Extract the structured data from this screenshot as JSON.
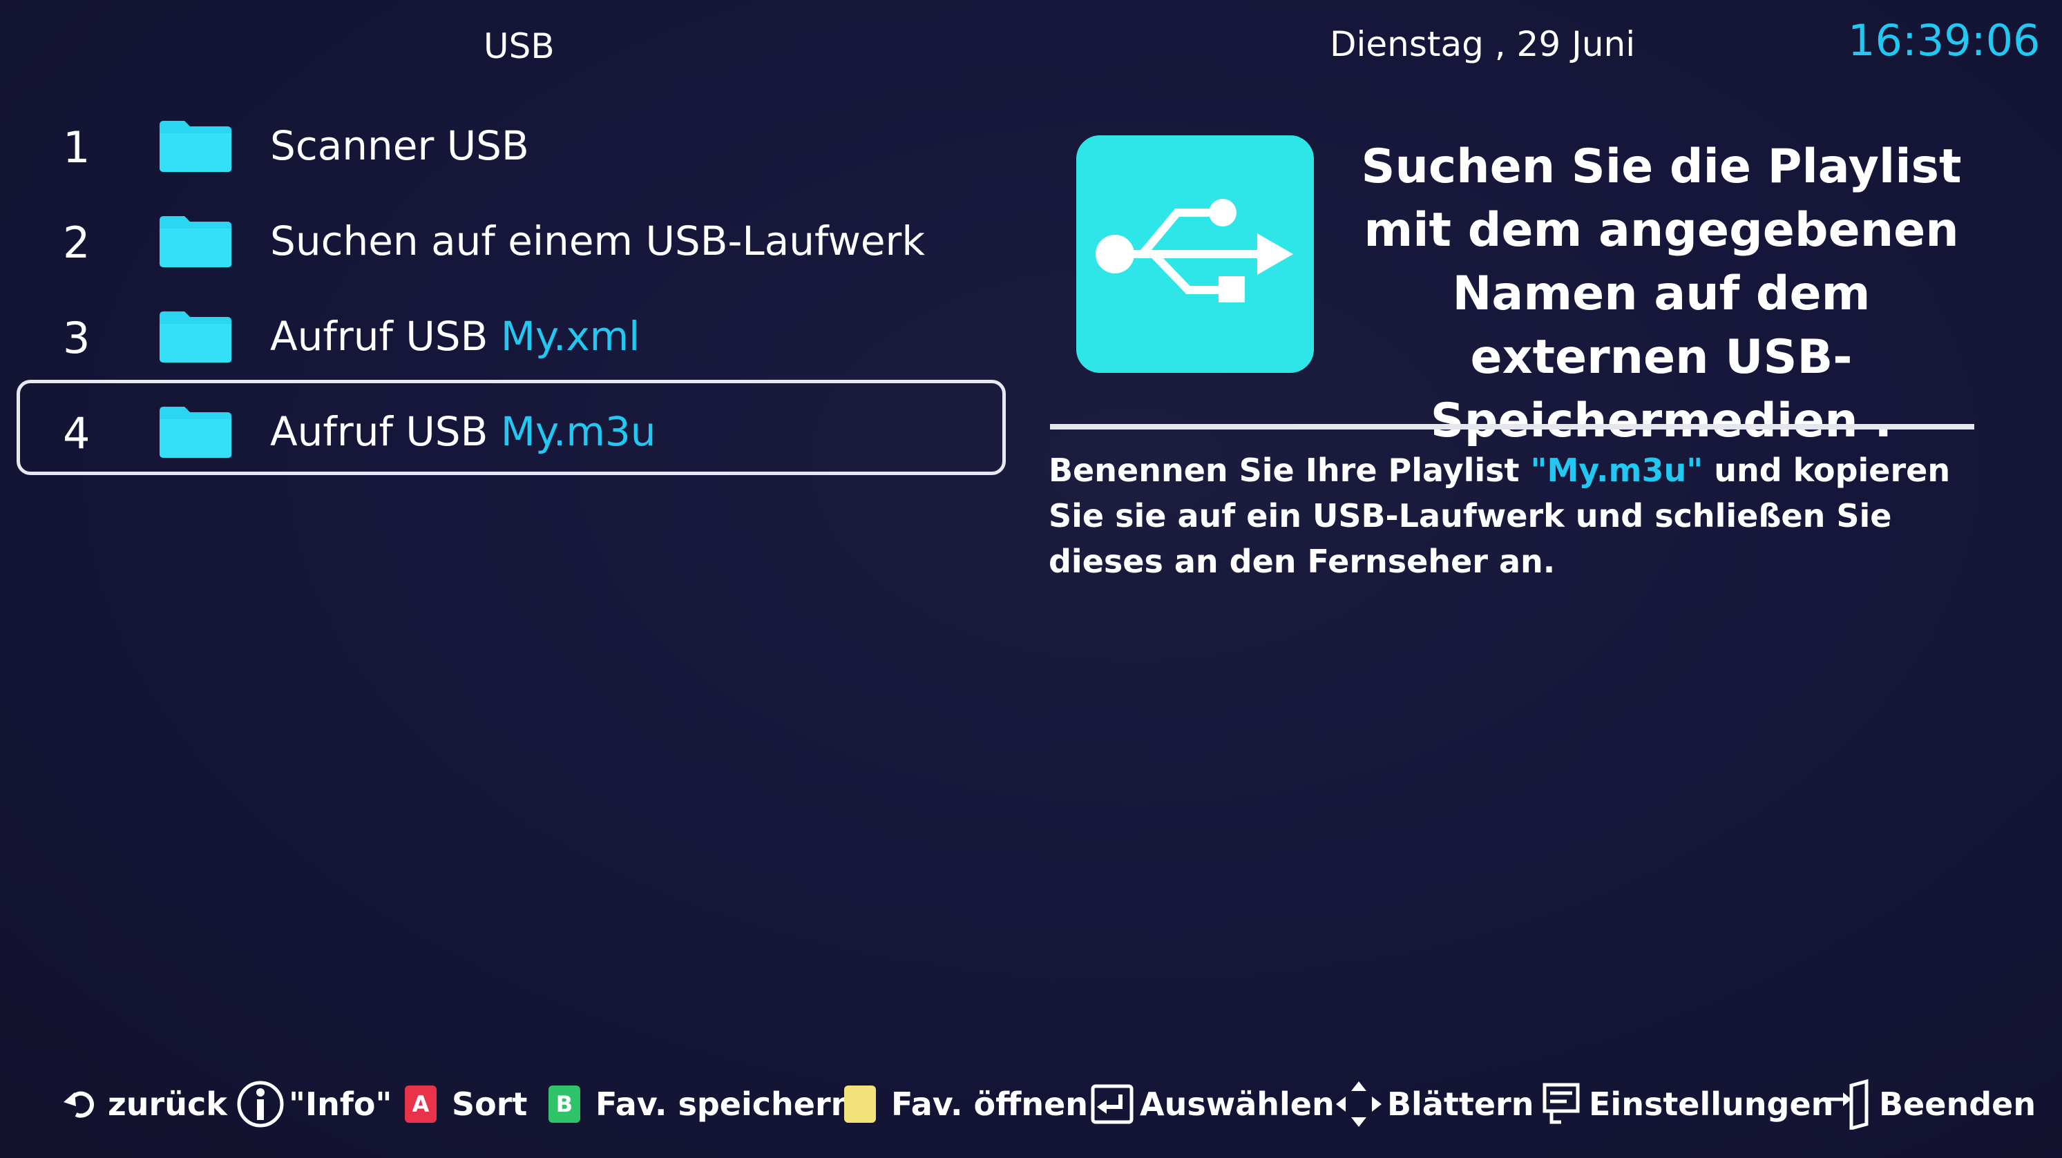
{
  "header": {
    "title": "USB",
    "date": "Dienstag , 29 Juni",
    "time": "16:39:06"
  },
  "list": {
    "items": [
      {
        "number": "1",
        "label": "Scanner USB",
        "highlight": ""
      },
      {
        "number": "2",
        "label": "Suchen auf einem USB-Laufwerk",
        "highlight": ""
      },
      {
        "number": "3",
        "label": "Aufruf USB ",
        "highlight": "My.xml"
      },
      {
        "number": "4",
        "label": "Aufruf USB ",
        "highlight": "My.m3u"
      }
    ],
    "selected_index": 4
  },
  "info": {
    "icon": "usb-icon",
    "heading": "Suchen Sie die Playlist mit dem angegebenen Namen auf dem externen USB-Speichermedien .",
    "body_before": "Benennen Sie Ihre Playlist ",
    "body_highlight": "\"My.m3u\"",
    "body_after": " und kopieren Sie sie auf ein USB-Laufwerk und schließen Sie dieses an den Fernseher an."
  },
  "footer": {
    "back": "zurück",
    "info": "\"Info\"",
    "key_a": "A",
    "sort": "Sort",
    "key_b": "B",
    "fav_save": "Fav. speichern",
    "fav_open": "Fav. öffnen",
    "select": "Auswählen",
    "browse": "Blättern",
    "settings": "Einstellungen",
    "exit": "Beenden"
  },
  "colors": {
    "accent": "#20c8f2",
    "folder": "#2ad6f2",
    "usb_tile": "#2ee5e8",
    "key_red": "#e8334a",
    "key_green": "#2fc46a",
    "key_yellow": "#f2e27a",
    "background": "#16163a"
  }
}
